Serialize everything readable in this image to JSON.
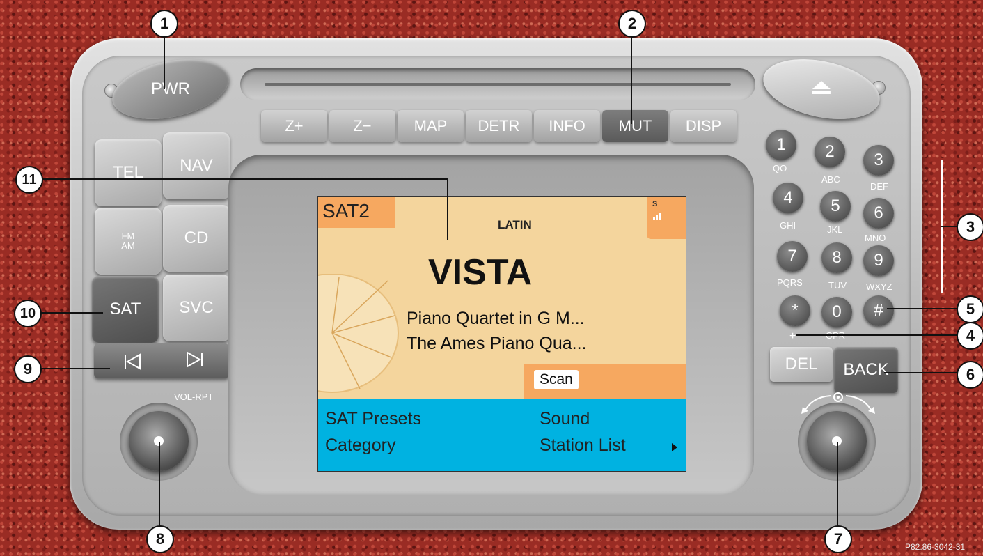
{
  "device": {
    "pwr_label": "PWR",
    "eject_icon": "eject-icon",
    "function_keys": [
      "Z+",
      "Z−",
      "MAP",
      "DETR",
      "INFO",
      "MUT",
      "DISP"
    ],
    "source_keys": {
      "tel": "TEL",
      "nav": "NAV",
      "fm": "FM",
      "am": "AM",
      "cd": "CD",
      "sat": "SAT",
      "svc": "SVC"
    },
    "seek_back_icon": "skip-back-icon",
    "seek_forward_icon": "skip-forward-icon",
    "vol_label": "VOL-RPT",
    "keypad": [
      {
        "key": "1",
        "sub": "QO"
      },
      {
        "key": "2",
        "sub": "ABC"
      },
      {
        "key": "3",
        "sub": "DEF"
      },
      {
        "key": "4",
        "sub": "GHI"
      },
      {
        "key": "5",
        "sub": "JKL"
      },
      {
        "key": "6",
        "sub": "MNO"
      },
      {
        "key": "7",
        "sub": "PQRS"
      },
      {
        "key": "8",
        "sub": "TUV"
      },
      {
        "key": "9",
        "sub": "WXYZ"
      },
      {
        "key": "*",
        "sub": "+"
      },
      {
        "key": "0",
        "sub": "OPR"
      },
      {
        "key": "#",
        "sub": ""
      }
    ],
    "del_label": "DEL",
    "back_label": "BACK"
  },
  "screen": {
    "source": "SAT2",
    "category": "LATIN",
    "signal_label": "S",
    "station": "VISTA",
    "line1": "Piano Quartet in G M...",
    "line2": "The Ames Piano Qua...",
    "scan_label": "Scan",
    "menu": {
      "sat_presets": "SAT Presets",
      "sound": "Sound",
      "category": "Category",
      "station_list": "Station List"
    },
    "colors": {
      "background": "#f4d59d",
      "accent_orange": "#f6a860",
      "menu_blue": "#00b2e1"
    }
  },
  "callouts": [
    "1",
    "2",
    "3",
    "4",
    "5",
    "6",
    "7",
    "8",
    "9",
    "10",
    "11"
  ],
  "figure_code": "P82.86-3042-31"
}
